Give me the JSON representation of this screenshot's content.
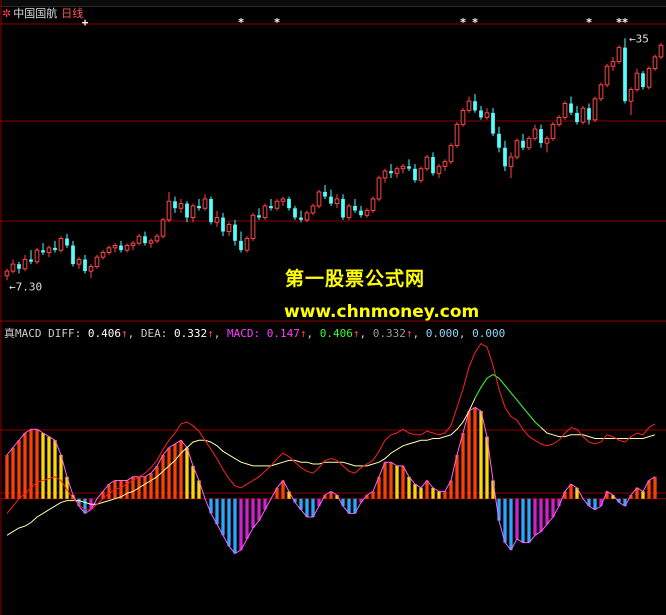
{
  "header": {
    "icon": "✲",
    "stock_name": "中国国航",
    "period": "日线"
  },
  "indicator": {
    "name": "真MACD",
    "diff_label": "DIFF",
    "diff_value": "0.406",
    "diff_arrow": "↑",
    "dea_label": "DEA",
    "dea_value": "0.332",
    "dea_arrow": "↑",
    "macd_label": "MACD",
    "macd_value": "0.147",
    "macd_arrow": "↑",
    "v4": "0.406",
    "v4_arrow": "↑",
    "v5": "0.332",
    "v5_arrow": "↑",
    "v6": "0.000",
    "v7": "0.000"
  },
  "watermark": {
    "line1": "第一股票公式网",
    "line2": "www.chnmoney.com"
  },
  "colors": {
    "up": "#ff4444",
    "down": "#54ffff",
    "grid": "#8b0000",
    "diff": "#ff2020",
    "dea": "#ffffaa",
    "ma_line": "#ff60ff",
    "hist_up": "#ff4000",
    "hist_mid": "#ffd700",
    "hist_down": "#2aa8ff",
    "hist_down2": "#d020d0"
  },
  "chart_data": [
    {
      "type": "candlestick",
      "title": "",
      "annotations": [
        {
          "text": "7.30",
          "kind": "low-marker"
        },
        {
          "text": "35",
          "kind": "high-marker"
        }
      ],
      "signal_marks": [
        {
          "bar": 13,
          "glyph": "+"
        },
        {
          "bar": 39,
          "glyph": "*"
        },
        {
          "bar": 45,
          "glyph": "*"
        },
        {
          "bar": 76,
          "glyph": "*"
        },
        {
          "bar": 78,
          "glyph": "*"
        },
        {
          "bar": 97,
          "glyph": "*"
        },
        {
          "bar": 102,
          "glyph": "*"
        },
        {
          "bar": 103,
          "glyph": "*"
        }
      ],
      "ylim": [
        6.4,
        12.8
      ],
      "candles": [
        [
          7.35,
          7.5,
          7.25,
          7.45
        ],
        [
          7.45,
          7.7,
          7.4,
          7.6
        ],
        [
          7.6,
          7.65,
          7.4,
          7.5
        ],
        [
          7.5,
          7.8,
          7.45,
          7.7
        ],
        [
          7.7,
          7.9,
          7.6,
          7.65
        ],
        [
          7.65,
          7.95,
          7.6,
          7.9
        ],
        [
          7.9,
          8.05,
          7.8,
          7.85
        ],
        [
          7.85,
          8.0,
          7.75,
          7.95
        ],
        [
          7.95,
          8.1,
          7.85,
          7.9
        ],
        [
          7.9,
          8.2,
          7.85,
          8.15
        ],
        [
          8.15,
          8.25,
          7.95,
          8.0
        ],
        [
          8.0,
          8.1,
          7.55,
          7.6
        ],
        [
          7.6,
          7.75,
          7.5,
          7.7
        ],
        [
          7.7,
          7.8,
          7.4,
          7.45
        ],
        [
          7.45,
          7.6,
          7.3,
          7.55
        ],
        [
          7.55,
          7.8,
          7.5,
          7.75
        ],
        [
          7.75,
          7.9,
          7.7,
          7.85
        ],
        [
          7.85,
          8.0,
          7.8,
          7.95
        ],
        [
          7.95,
          8.05,
          7.85,
          8.0
        ],
        [
          8.0,
          8.1,
          7.85,
          7.9
        ],
        [
          7.9,
          8.05,
          7.85,
          8.0
        ],
        [
          8.0,
          8.1,
          7.9,
          8.05
        ],
        [
          8.05,
          8.25,
          8.0,
          8.2
        ],
        [
          8.2,
          8.3,
          8.0,
          8.05
        ],
        [
          8.05,
          8.15,
          7.95,
          8.1
        ],
        [
          8.1,
          8.25,
          8.05,
          8.2
        ],
        [
          8.2,
          8.6,
          8.15,
          8.55
        ],
        [
          8.55,
          9.15,
          8.5,
          8.95
        ],
        [
          8.95,
          9.05,
          8.7,
          8.8
        ],
        [
          8.8,
          9.0,
          8.7,
          8.9
        ],
        [
          8.9,
          8.95,
          8.5,
          8.6
        ],
        [
          8.6,
          8.9,
          8.5,
          8.85
        ],
        [
          8.85,
          9.0,
          8.75,
          8.8
        ],
        [
          8.8,
          9.1,
          8.75,
          9.0
        ],
        [
          9.0,
          9.05,
          8.45,
          8.5
        ],
        [
          8.5,
          8.75,
          8.4,
          8.6
        ],
        [
          8.6,
          8.7,
          8.2,
          8.3
        ],
        [
          8.3,
          8.5,
          8.2,
          8.45
        ],
        [
          8.45,
          8.55,
          8.0,
          8.1
        ],
        [
          8.1,
          8.3,
          7.85,
          7.9
        ],
        [
          7.9,
          8.2,
          7.85,
          8.15
        ],
        [
          8.15,
          8.7,
          8.1,
          8.65
        ],
        [
          8.65,
          8.8,
          8.55,
          8.6
        ],
        [
          8.6,
          8.9,
          8.55,
          8.85
        ],
        [
          8.85,
          9.0,
          8.75,
          8.8
        ],
        [
          8.8,
          9.0,
          8.75,
          8.95
        ],
        [
          8.95,
          9.05,
          8.85,
          9.0
        ],
        [
          9.0,
          9.05,
          8.75,
          8.8
        ],
        [
          8.8,
          8.85,
          8.55,
          8.6
        ],
        [
          8.6,
          8.75,
          8.5,
          8.55
        ],
        [
          8.55,
          8.75,
          8.5,
          8.7
        ],
        [
          8.7,
          8.9,
          8.65,
          8.85
        ],
        [
          8.85,
          9.2,
          8.8,
          9.15
        ],
        [
          9.15,
          9.3,
          9.0,
          9.05
        ],
        [
          9.05,
          9.2,
          8.85,
          8.9
        ],
        [
          8.9,
          9.1,
          8.8,
          9.0
        ],
        [
          9.0,
          9.1,
          8.55,
          8.6
        ],
        [
          8.6,
          8.9,
          8.55,
          8.85
        ],
        [
          8.85,
          9.0,
          8.7,
          8.75
        ],
        [
          8.75,
          8.85,
          8.6,
          8.65
        ],
        [
          8.65,
          8.8,
          8.6,
          8.75
        ],
        [
          8.75,
          9.05,
          8.7,
          9.0
        ],
        [
          9.0,
          9.5,
          8.95,
          9.45
        ],
        [
          9.45,
          9.65,
          9.35,
          9.6
        ],
        [
          9.6,
          9.75,
          9.45,
          9.55
        ],
        [
          9.55,
          9.7,
          9.45,
          9.65
        ],
        [
          9.65,
          9.75,
          9.55,
          9.7
        ],
        [
          9.7,
          9.85,
          9.6,
          9.65
        ],
        [
          9.65,
          9.75,
          9.35,
          9.4
        ],
        [
          9.4,
          9.7,
          9.35,
          9.65
        ],
        [
          9.65,
          9.95,
          9.6,
          9.9
        ],
        [
          9.9,
          10.0,
          9.5,
          9.55
        ],
        [
          9.55,
          9.75,
          9.45,
          9.7
        ],
        [
          9.7,
          9.85,
          9.6,
          9.8
        ],
        [
          9.8,
          10.2,
          9.75,
          10.15
        ],
        [
          10.15,
          10.65,
          10.1,
          10.6
        ],
        [
          10.6,
          10.95,
          10.55,
          10.9
        ],
        [
          10.9,
          11.2,
          10.85,
          11.1
        ],
        [
          11.1,
          11.25,
          10.85,
          10.9
        ],
        [
          10.9,
          11.0,
          10.7,
          10.75
        ],
        [
          10.75,
          10.95,
          10.7,
          10.85
        ],
        [
          10.85,
          10.95,
          10.35,
          10.4
        ],
        [
          10.4,
          10.55,
          10.0,
          10.1
        ],
        [
          10.1,
          10.25,
          9.6,
          9.7
        ],
        [
          9.7,
          10.0,
          9.45,
          9.9
        ],
        [
          9.9,
          10.3,
          9.85,
          10.25
        ],
        [
          10.25,
          10.4,
          10.05,
          10.1
        ],
        [
          10.1,
          10.35,
          10.05,
          10.3
        ],
        [
          10.3,
          10.6,
          10.25,
          10.5
        ],
        [
          10.5,
          10.6,
          10.1,
          10.2
        ],
        [
          10.2,
          10.35,
          10.0,
          10.3
        ],
        [
          10.3,
          10.65,
          10.25,
          10.6
        ],
        [
          10.6,
          10.8,
          10.55,
          10.75
        ],
        [
          10.75,
          11.1,
          10.7,
          11.05
        ],
        [
          11.05,
          11.2,
          10.8,
          10.85
        ],
        [
          10.85,
          11.0,
          10.6,
          10.65
        ],
        [
          10.65,
          11.0,
          10.6,
          10.95
        ],
        [
          10.95,
          11.05,
          10.6,
          10.7
        ],
        [
          10.7,
          11.2,
          10.65,
          11.15
        ],
        [
          11.15,
          11.5,
          11.1,
          11.45
        ],
        [
          11.45,
          11.9,
          11.4,
          11.85
        ],
        [
          11.85,
          12.05,
          11.75,
          11.95
        ],
        [
          11.95,
          12.3,
          11.9,
          12.25
        ],
        [
          12.25,
          12.45,
          11.05,
          11.1
        ],
        [
          11.1,
          11.4,
          10.8,
          11.35
        ],
        [
          11.35,
          11.8,
          11.3,
          11.7
        ],
        [
          11.7,
          11.75,
          11.35,
          11.4
        ],
        [
          11.4,
          11.85,
          11.35,
          11.8
        ],
        [
          11.8,
          12.1,
          11.75,
          12.05
        ],
        [
          12.05,
          12.35,
          12.0,
          12.3
        ]
      ]
    },
    {
      "type": "bar",
      "title": "真MACD",
      "ylim": [
        -0.62,
        0.88
      ],
      "series": [
        {
          "name": "DIFF",
          "kind": "line",
          "values": [
            -0.08,
            -0.04,
            0.0,
            0.03,
            0.06,
            0.09,
            0.1,
            0.11,
            0.12,
            0.1,
            0.05,
            0.0,
            -0.03,
            -0.06,
            -0.06,
            -0.03,
            0.0,
            0.03,
            0.05,
            0.06,
            0.08,
            0.1,
            0.12,
            0.14,
            0.17,
            0.21,
            0.27,
            0.32,
            0.36,
            0.41,
            0.42,
            0.4,
            0.37,
            0.32,
            0.27,
            0.22,
            0.16,
            0.11,
            0.07,
            0.06,
            0.08,
            0.1,
            0.12,
            0.15,
            0.18,
            0.22,
            0.25,
            0.23,
            0.2,
            0.17,
            0.15,
            0.14,
            0.17,
            0.21,
            0.22,
            0.21,
            0.18,
            0.15,
            0.14,
            0.17,
            0.19,
            0.21,
            0.26,
            0.32,
            0.35,
            0.36,
            0.38,
            0.36,
            0.35,
            0.35,
            0.37,
            0.36,
            0.35,
            0.36,
            0.4,
            0.5,
            0.6,
            0.72,
            0.8,
            0.85,
            0.83,
            0.73,
            0.6,
            0.5,
            0.45,
            0.43,
            0.38,
            0.34,
            0.32,
            0.3,
            0.29,
            0.3,
            0.32,
            0.36,
            0.39,
            0.38,
            0.34,
            0.31,
            0.3,
            0.31,
            0.35,
            0.34,
            0.32,
            0.31,
            0.34,
            0.36,
            0.35,
            0.39,
            0.41
          ]
        },
        {
          "name": "DEA",
          "kind": "line",
          "values": [
            -0.2,
            -0.18,
            -0.16,
            -0.15,
            -0.13,
            -0.1,
            -0.08,
            -0.06,
            -0.04,
            -0.02,
            -0.01,
            -0.01,
            -0.01,
            -0.02,
            -0.03,
            -0.03,
            -0.02,
            -0.01,
            0.0,
            0.01,
            0.03,
            0.04,
            0.06,
            0.08,
            0.1,
            0.12,
            0.15,
            0.18,
            0.21,
            0.25,
            0.28,
            0.31,
            0.32,
            0.32,
            0.31,
            0.29,
            0.26,
            0.24,
            0.22,
            0.2,
            0.19,
            0.18,
            0.18,
            0.18,
            0.18,
            0.19,
            0.2,
            0.21,
            0.21,
            0.2,
            0.2,
            0.19,
            0.19,
            0.2,
            0.2,
            0.2,
            0.2,
            0.19,
            0.18,
            0.18,
            0.18,
            0.19,
            0.2,
            0.22,
            0.25,
            0.27,
            0.29,
            0.3,
            0.31,
            0.32,
            0.32,
            0.33,
            0.33,
            0.34,
            0.35,
            0.38,
            0.42,
            0.48,
            0.55,
            0.61,
            0.66,
            0.68,
            0.66,
            0.62,
            0.58,
            0.54,
            0.5,
            0.46,
            0.42,
            0.39,
            0.36,
            0.35,
            0.34,
            0.34,
            0.35,
            0.35,
            0.35,
            0.34,
            0.33,
            0.33,
            0.33,
            0.33,
            0.33,
            0.33,
            0.33,
            0.33,
            0.33,
            0.34,
            0.35
          ]
        },
        {
          "name": "MACD",
          "kind": "histogram",
          "values": [
            0.24,
            0.28,
            0.32,
            0.36,
            0.38,
            0.38,
            0.36,
            0.34,
            0.32,
            0.24,
            0.12,
            0.02,
            -0.04,
            -0.08,
            -0.06,
            0.0,
            0.04,
            0.08,
            0.1,
            0.1,
            0.1,
            0.12,
            0.12,
            0.12,
            0.14,
            0.18,
            0.24,
            0.28,
            0.3,
            0.32,
            0.28,
            0.18,
            0.1,
            0.0,
            -0.08,
            -0.14,
            -0.2,
            -0.26,
            -0.3,
            -0.28,
            -0.22,
            -0.16,
            -0.12,
            -0.06,
            0.0,
            0.06,
            0.1,
            0.04,
            -0.02,
            -0.06,
            -0.1,
            -0.1,
            -0.04,
            0.02,
            0.04,
            0.02,
            -0.04,
            -0.08,
            -0.08,
            -0.02,
            0.02,
            0.04,
            0.12,
            0.2,
            0.2,
            0.18,
            0.18,
            0.12,
            0.08,
            0.06,
            0.1,
            0.06,
            0.04,
            0.04,
            0.1,
            0.24,
            0.36,
            0.48,
            0.5,
            0.48,
            0.34,
            0.1,
            -0.12,
            -0.24,
            -0.28,
            -0.22,
            -0.24,
            -0.24,
            -0.2,
            -0.18,
            -0.14,
            -0.1,
            -0.04,
            0.04,
            0.08,
            0.06,
            0.0,
            -0.04,
            -0.06,
            -0.04,
            0.04,
            0.02,
            -0.02,
            -0.04,
            0.02,
            0.06,
            0.04,
            0.1,
            0.12
          ]
        }
      ]
    }
  ]
}
